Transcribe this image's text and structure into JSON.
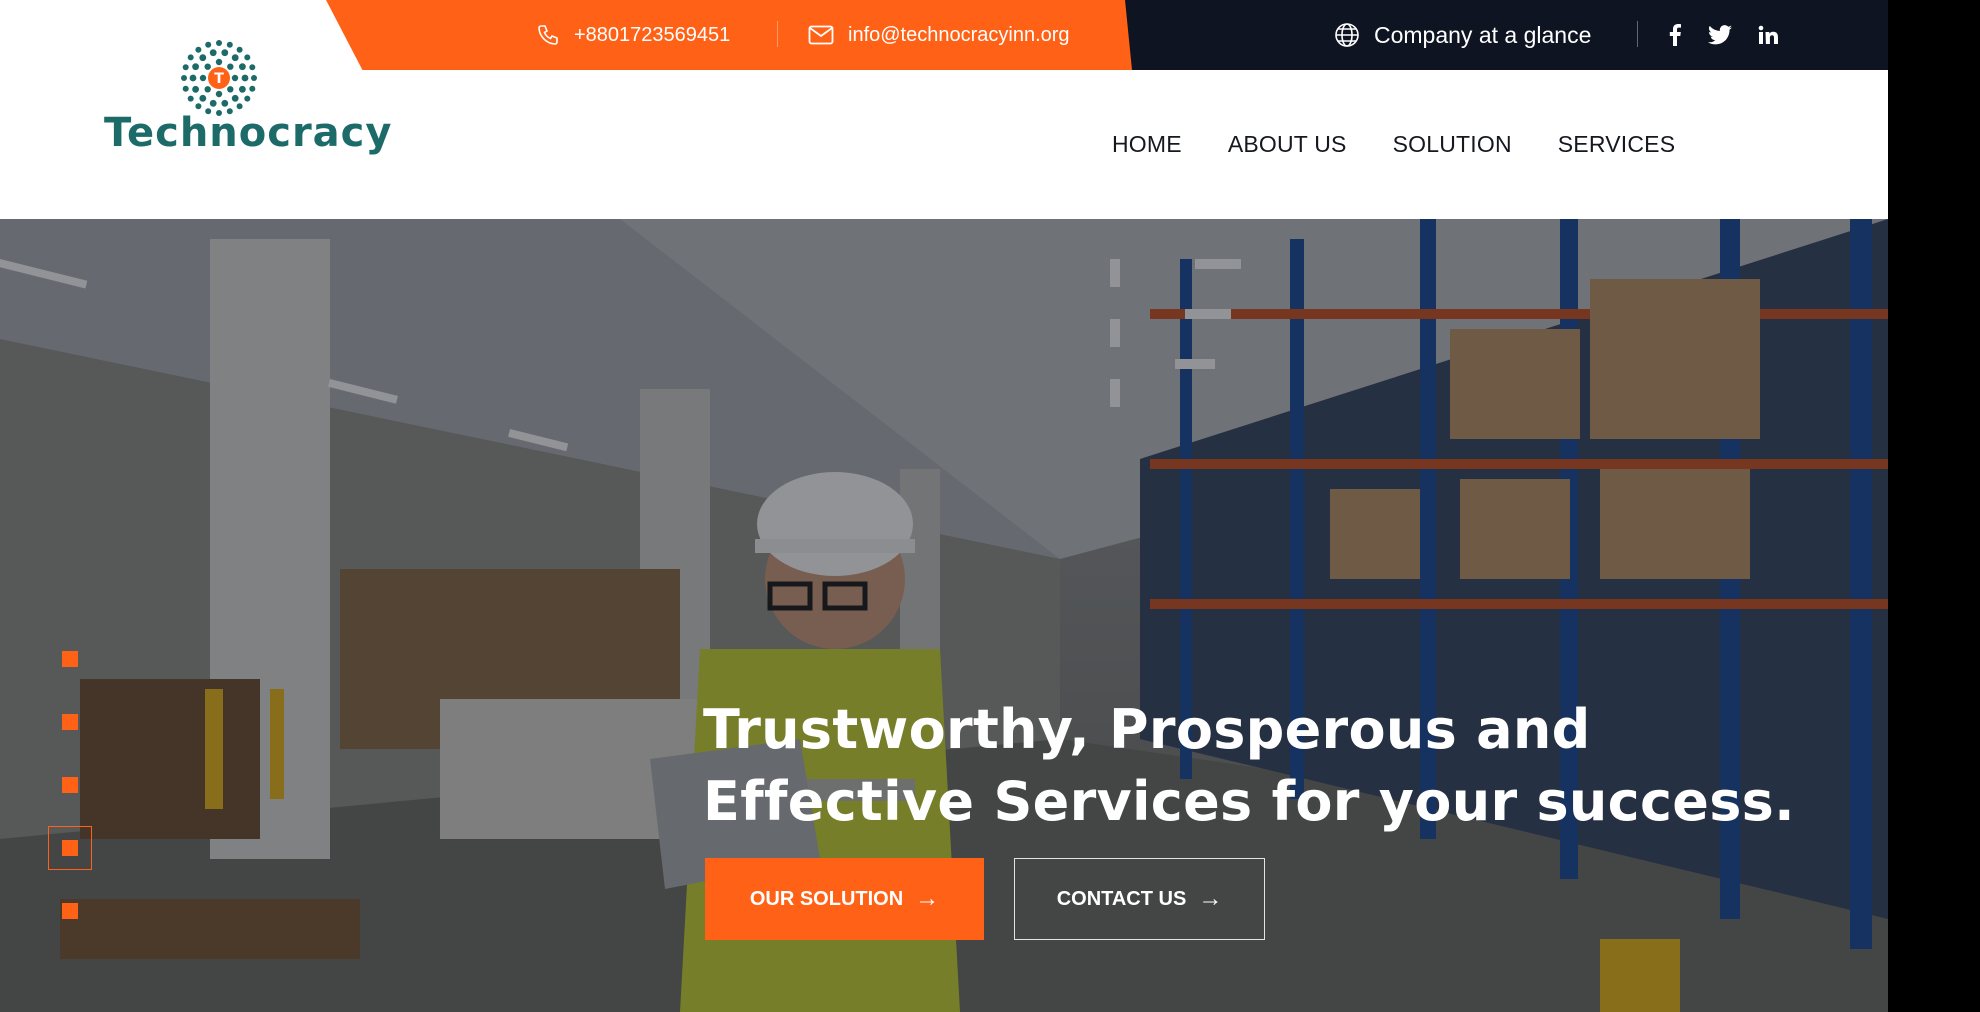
{
  "topbar": {
    "phone": "+8801723569451",
    "email": "info@technocracyinn.org",
    "company_link": "Company at a glance",
    "social": [
      "facebook-icon",
      "twitter-icon",
      "linkedin-icon"
    ]
  },
  "brand": {
    "name": "Technocracy",
    "emblem_letter": "T"
  },
  "nav": {
    "items": [
      "HOME",
      "ABOUT US",
      "SOLUTION",
      "SERVICES"
    ]
  },
  "hero": {
    "headline_line1": "Trustworthy, Prosperous and",
    "headline_line2": "Effective Services for your success.",
    "primary_button": "OUR SOLUTION",
    "secondary_button": "CONTACT US",
    "slides_total": 5,
    "active_slide": 4
  },
  "colors": {
    "accent": "#ff6216",
    "topbar_dark": "#0f1422",
    "brand_teal": "#1d6b69",
    "nav_text": "#15181f"
  }
}
